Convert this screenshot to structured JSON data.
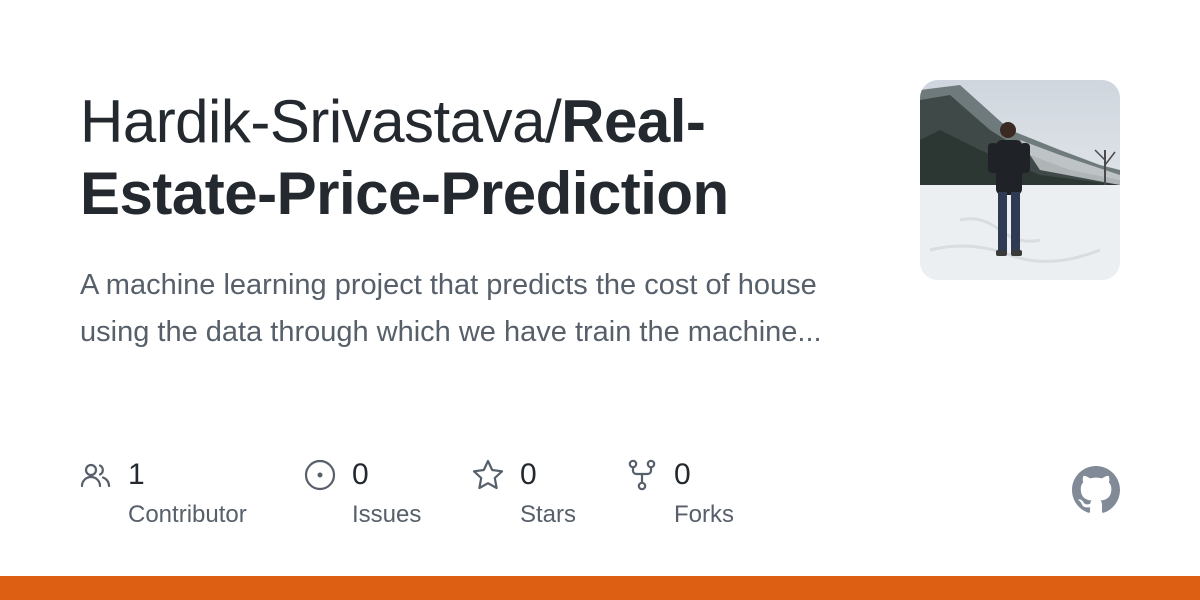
{
  "repo": {
    "owner": "Hardik-Srivastava/",
    "name_line1": "Real-",
    "name_line2": "Estate-Price-Prediction",
    "description": "A machine learning project that predicts the cost of house using the data through which we have train the machine..."
  },
  "stats": [
    {
      "icon": "people-icon",
      "value": "1",
      "label": "Contributor"
    },
    {
      "icon": "issue-circle-icon",
      "value": "0",
      "label": "Issues"
    },
    {
      "icon": "star-icon",
      "value": "0",
      "label": "Stars"
    },
    {
      "icon": "fork-icon",
      "value": "0",
      "label": "Forks"
    }
  ],
  "icons": {
    "brand": "github-logo-icon"
  },
  "colors": {
    "title": "#24292f",
    "muted": "#57606a",
    "icon": "#57606a",
    "bottom_bar": "#dc5f13",
    "github_logo": "#818b98"
  }
}
